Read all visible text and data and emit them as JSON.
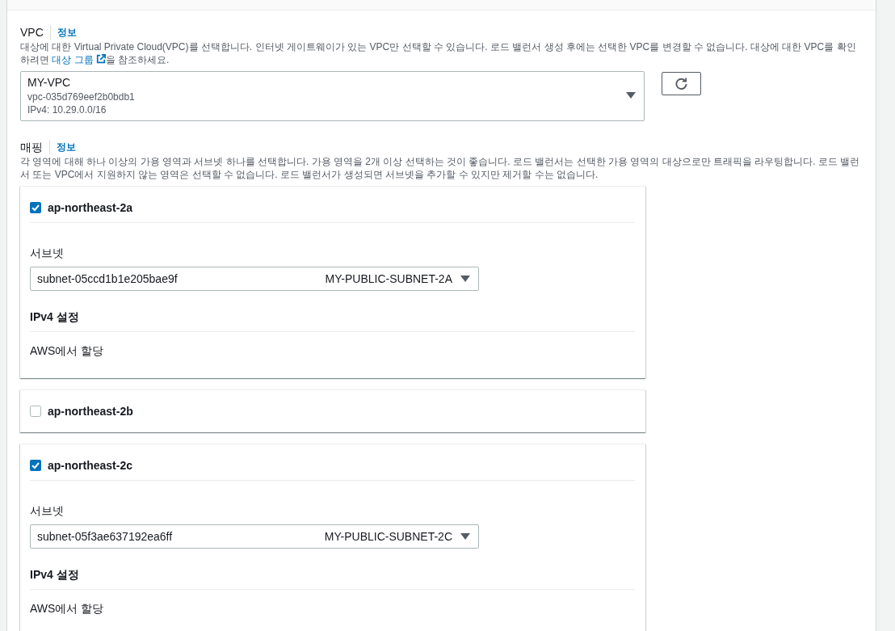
{
  "vpc": {
    "label": "VPC",
    "info_link": "정보",
    "description": {
      "before": "대상에 대한 Virtual Private Cloud(VPC)를 선택합니다. 인터넷 게이트웨이가 있는 VPC만 선택할 수 있습니다. 로드 밸런서 생성 후에는 선택한 VPC를 변경할 수 없습니다. 대상에 대한 VPC를 확인하려면 ",
      "link": "대상 그룹",
      "after": "을 참조하세요."
    },
    "selected": {
      "name": "MY-VPC",
      "id": "vpc-035d769eef2b0bdb1",
      "cidr": "IPv4: 10.29.0.0/16"
    }
  },
  "mapping": {
    "label": "매핑",
    "info_link": "정보",
    "description": "각 영역에 대해 하나 이상의 가용 영역과 서브넷 하나를 선택합니다. 가용 영역을 2개 이상 선택하는 것이 좋습니다. 로드 밸런서는 선택한 가용 영역의 대상으로만 트래픽을 라우팅합니다. 로드 밸런서 또는 VPC에서 지원하지 않는 영역은 선택할 수 없습니다. 로드 밸런서가 생성되면 서브넷을 추가할 수 있지만 제거할 수는 없습니다.",
    "zones": [
      {
        "name": "ap-northeast-2a",
        "checked": true,
        "subnet_label": "서브넷",
        "subnet_id": "subnet-05ccd1b1e205bae9f",
        "subnet_name": "MY-PUBLIC-SUBNET-2A",
        "ipv4_label": "IPv4 설정",
        "ipv4_value": "AWS에서 할당"
      },
      {
        "name": "ap-northeast-2b",
        "checked": false
      },
      {
        "name": "ap-northeast-2c",
        "checked": true,
        "subnet_label": "서브넷",
        "subnet_id": "subnet-05f3ae637192ea6ff",
        "subnet_name": "MY-PUBLIC-SUBNET-2C",
        "ipv4_label": "IPv4 설정",
        "ipv4_value": "AWS에서 할당"
      }
    ]
  }
}
